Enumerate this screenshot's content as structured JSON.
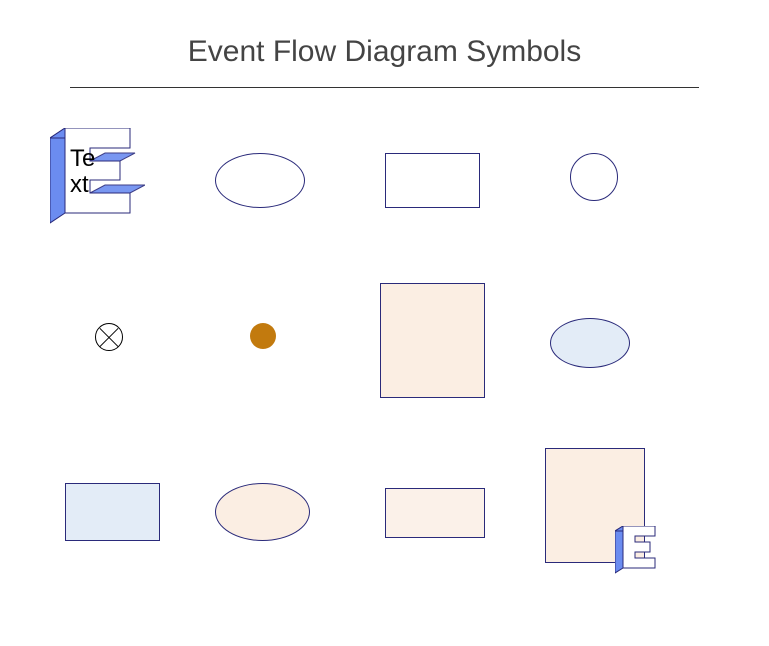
{
  "title": "Event Flow Diagram Symbols",
  "symbols": {
    "e_block_text": "Te\nxt",
    "colors": {
      "stroke": "#2a2a7a",
      "blue_fill": "#e3ecf7",
      "peach_fill": "#fbeee3",
      "light_peach": "#fbf1e9",
      "e_side": "#6b8cf0",
      "e_front": "#ffffff",
      "dot": "#c27a0e"
    },
    "shapes": [
      {
        "name": "3d-e-block",
        "row": 1,
        "col": 1,
        "type": "e3d"
      },
      {
        "name": "ellipse-plain",
        "row": 1,
        "col": 2,
        "type": "ellipse"
      },
      {
        "name": "rectangle-plain",
        "row": 1,
        "col": 3,
        "type": "rect"
      },
      {
        "name": "circle-plain",
        "row": 1,
        "col": 4,
        "type": "circle"
      },
      {
        "name": "xor-gate",
        "row": 2,
        "col": 1,
        "type": "xor"
      },
      {
        "name": "filled-dot",
        "row": 2,
        "col": 2,
        "type": "dot"
      },
      {
        "name": "rectangle-peach-large",
        "row": 2,
        "col": 3,
        "type": "rect-fill"
      },
      {
        "name": "ellipse-blue",
        "row": 2,
        "col": 4,
        "type": "ellipse-fill"
      },
      {
        "name": "rectangle-blue",
        "row": 3,
        "col": 1,
        "type": "rect-fill"
      },
      {
        "name": "ellipse-peach",
        "row": 3,
        "col": 2,
        "type": "ellipse-fill"
      },
      {
        "name": "rectangle-peach-small",
        "row": 3,
        "col": 3,
        "type": "rect-fill"
      },
      {
        "name": "rectangle-peach-with-e",
        "row": 3,
        "col": 4,
        "type": "rect-with-e"
      }
    ]
  }
}
